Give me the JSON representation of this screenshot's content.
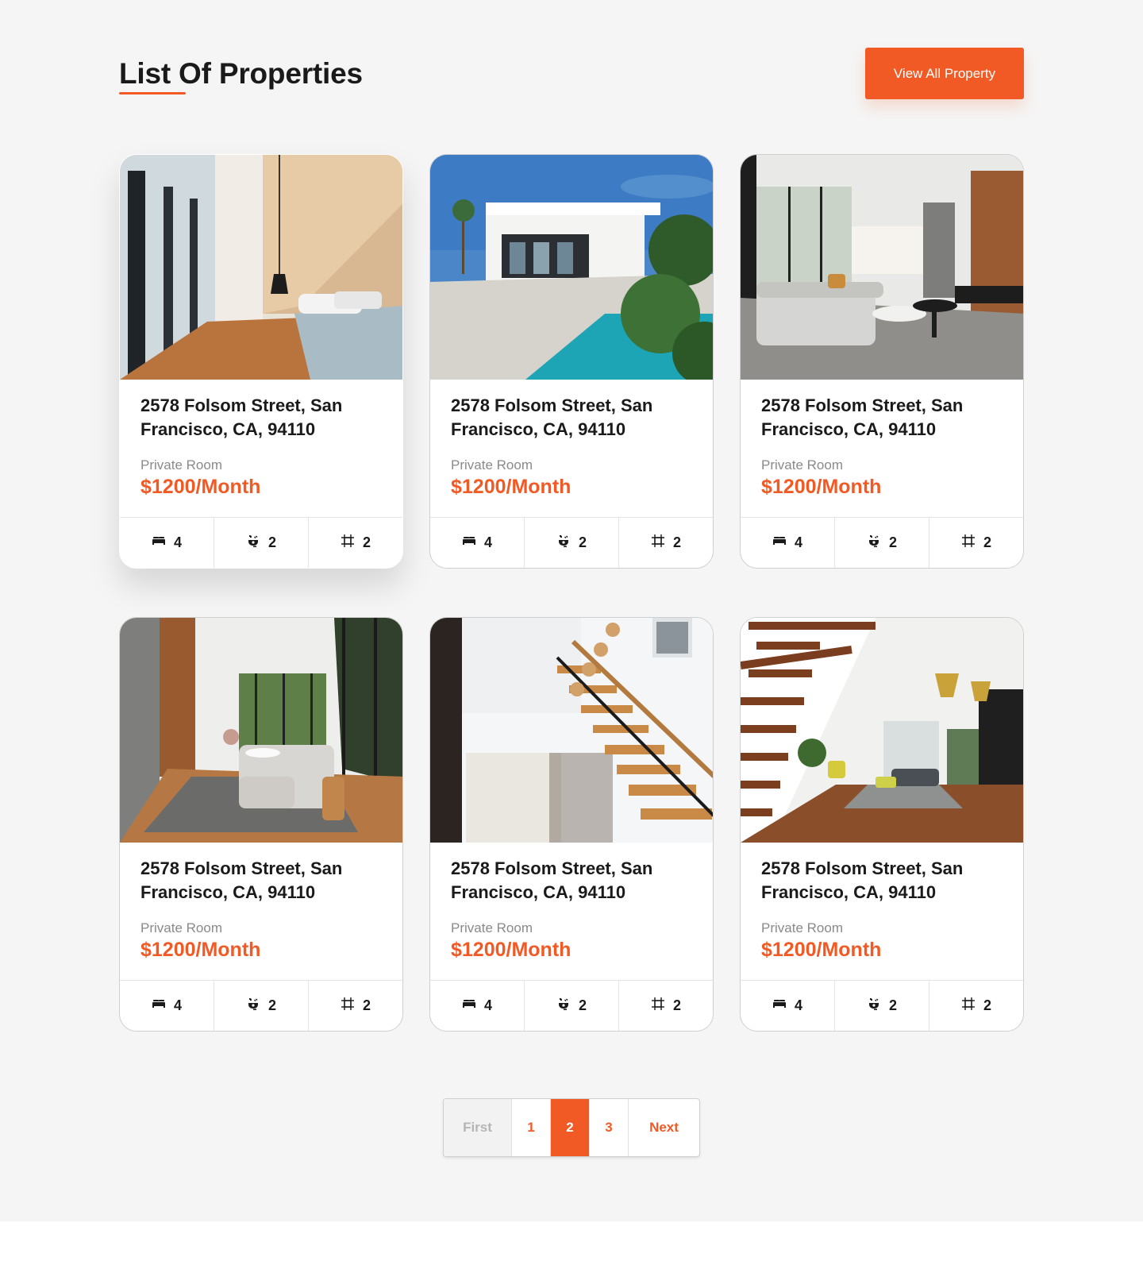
{
  "header": {
    "title": "List Of Properties",
    "view_all_label": "View All Property"
  },
  "colors": {
    "accent": "#f15a24",
    "background": "#f5f5f5"
  },
  "properties": [
    {
      "address": "2578 Folsom Street, San Francisco, CA, 94110",
      "room_type": "Private Room",
      "price": "$1200/Month",
      "beds": "4",
      "baths": "2",
      "area": "2",
      "photo": "bedroom"
    },
    {
      "address": "2578 Folsom Street, San Francisco, CA, 94110",
      "room_type": "Private Room",
      "price": "$1200/Month",
      "beds": "4",
      "baths": "2",
      "area": "2",
      "photo": "villa-pool"
    },
    {
      "address": "2578 Folsom Street, San Francisco, CA, 94110",
      "room_type": "Private Room",
      "price": "$1200/Month",
      "beds": "4",
      "baths": "2",
      "area": "2",
      "photo": "living-room"
    },
    {
      "address": "2578 Folsom Street, San Francisco, CA, 94110",
      "room_type": "Private Room",
      "price": "$1200/Month",
      "beds": "4",
      "baths": "2",
      "area": "2",
      "photo": "lounge"
    },
    {
      "address": "2578 Folsom Street, San Francisco, CA, 94110",
      "room_type": "Private Room",
      "price": "$1200/Month",
      "beds": "4",
      "baths": "2",
      "area": "2",
      "photo": "staircase"
    },
    {
      "address": "2578 Folsom Street, San Francisco, CA, 94110",
      "room_type": "Private Room",
      "price": "$1200/Month",
      "beds": "4",
      "baths": "2",
      "area": "2",
      "photo": "open-plan"
    }
  ],
  "feature_icons": [
    "bed-icon",
    "bath-icon",
    "area-icon"
  ],
  "pagination": {
    "first_label": "First",
    "pages": [
      "1",
      "2",
      "3"
    ],
    "active_page": "2",
    "next_label": "Next"
  }
}
